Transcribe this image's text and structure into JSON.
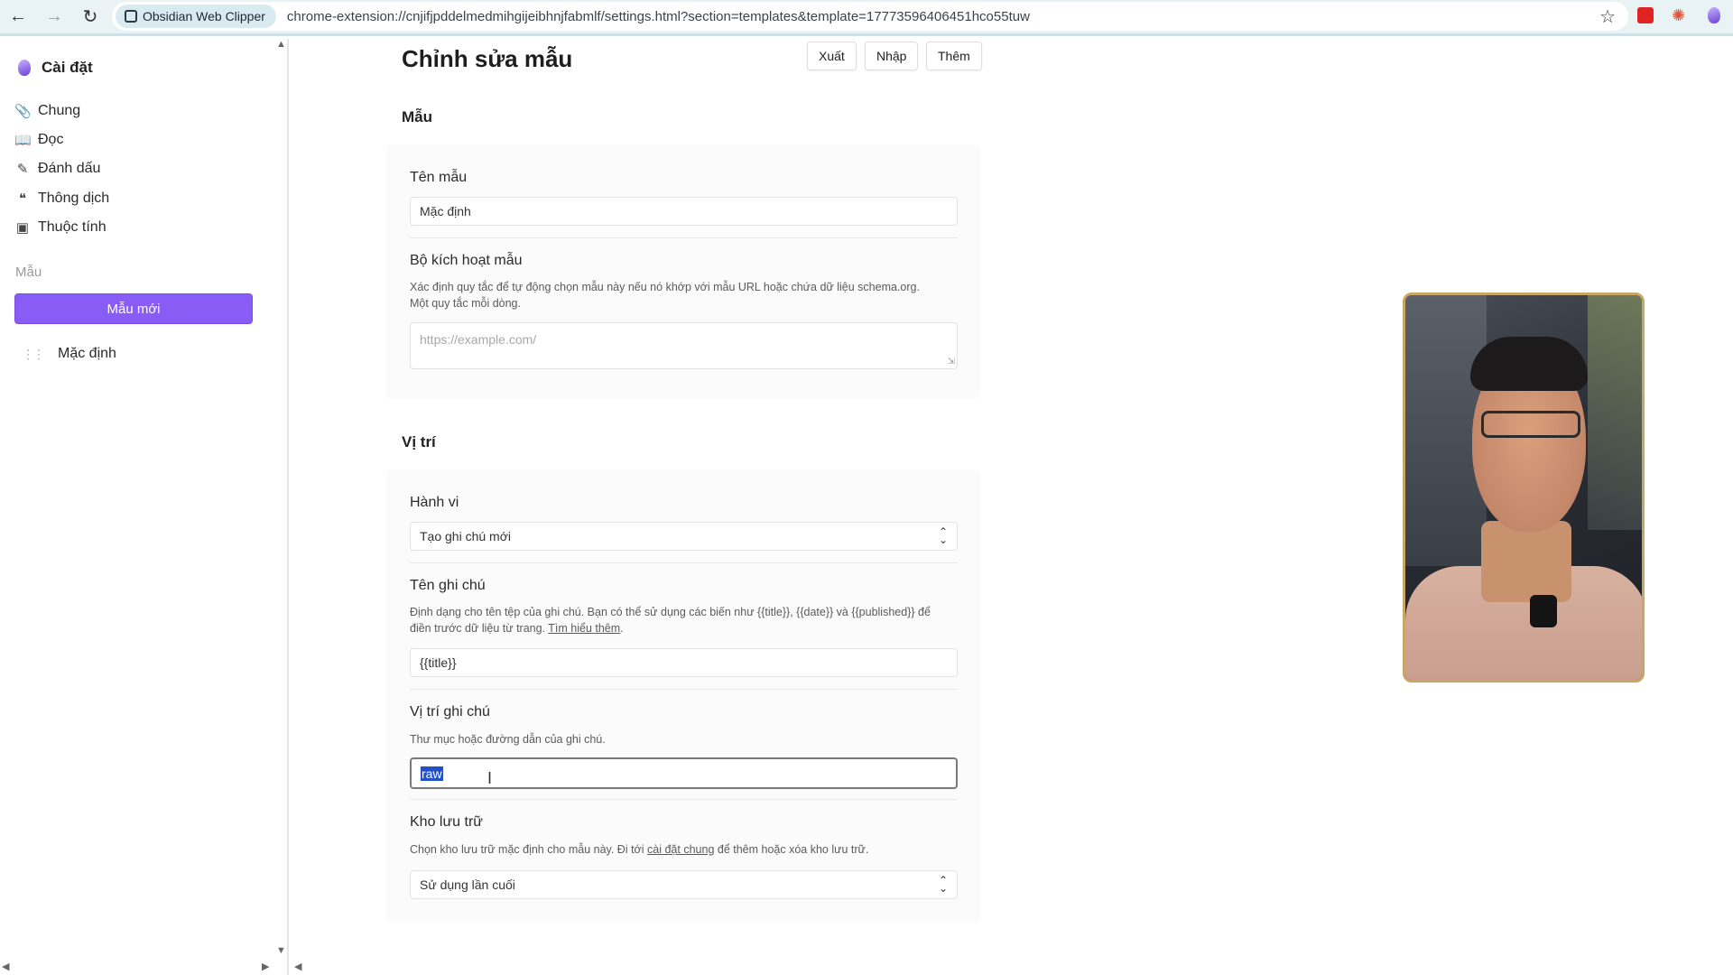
{
  "browser": {
    "extension_chip": "Obsidian Web Clipper",
    "url": "chrome-extension://cnjifjpddelmedmihgijeibhnjfabmlf/settings.html?section=templates&template=17773596406451hco55tuw"
  },
  "sidebar": {
    "title": "Cài đặt",
    "items": [
      {
        "label": "Chung",
        "icon": "paperclip-icon"
      },
      {
        "label": "Đọc",
        "icon": "book-icon"
      },
      {
        "label": "Đánh dấu",
        "icon": "highlighter-icon"
      },
      {
        "label": "Thông dịch",
        "icon": "quote-icon"
      },
      {
        "label": "Thuộc tính",
        "icon": "archive-icon"
      }
    ],
    "section_label": "Mẫu",
    "new_button": "Mẫu mới",
    "templates": [
      {
        "label": "Mặc định"
      }
    ]
  },
  "main": {
    "title": "Chỉnh sửa mẫu",
    "actions": {
      "export": "Xuất",
      "import": "Nhập",
      "more": "Thêm"
    },
    "template_section": {
      "heading": "Mẫu",
      "name_label": "Tên mẫu",
      "name_value": "Mặc định",
      "trigger_label": "Bộ kích hoạt mẫu",
      "trigger_desc_1": "Xác định quy tắc để tự động chọn mẫu này nếu nó khớp với mẫu URL hoặc chứa dữ liệu schema.org.",
      "trigger_desc_2": "Một quy tắc mỗi dòng.",
      "trigger_placeholder": "https://example.com/"
    },
    "location_section": {
      "heading": "Vị trí",
      "behavior_label": "Hành vi",
      "behavior_value": "Tạo ghi chú mới",
      "note_name_label": "Tên ghi chú",
      "note_name_desc_1": "Định dạng cho tên tệp của ghi chú. Bạn có thể sử dụng các biến như {{title}}, {{date}} và {{published}} để",
      "note_name_desc_2": "điền trước dữ liệu từ trang.",
      "note_name_link": "Tìm hiểu thêm",
      "note_name_value": "{{title}}",
      "note_location_label": "Vị trí ghi chú",
      "note_location_desc": "Thư mục hoặc đường dẫn của ghi chú.",
      "note_location_value": "raw",
      "vault_label": "Kho lưu trữ",
      "vault_desc_1": "Chọn kho lưu trữ mặc định cho mẫu này. Đi tới",
      "vault_desc_link": "cài đặt chung",
      "vault_desc_2": "để thêm hoặc xóa kho lưu trữ.",
      "vault_value": "Sử dụng lần cuối"
    }
  },
  "colors": {
    "accent": "#8a5cf6",
    "selection": "#2350c8",
    "webcam_border": "#c9a566"
  }
}
